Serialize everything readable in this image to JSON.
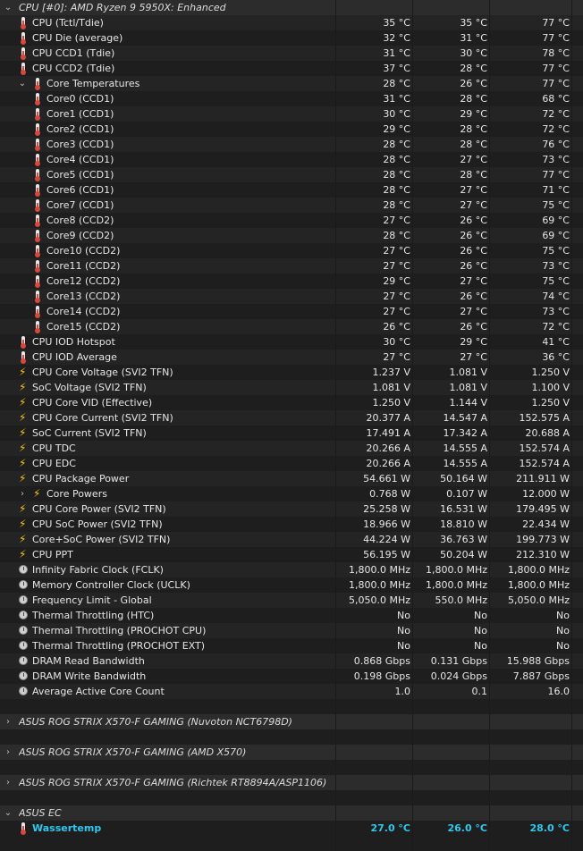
{
  "sections": [
    {
      "title": "CPU [#0]: AMD Ryzen 9 5950X: Enhanced",
      "expanded": true,
      "rows": [
        {
          "icon": "thermometer",
          "label": "CPU (Tctl/Tdie)",
          "v1": "35 °C",
          "v2": "35 °C",
          "v3": "77 °C"
        },
        {
          "icon": "thermometer",
          "label": "CPU Die (average)",
          "v1": "32 °C",
          "v2": "31 °C",
          "v3": "77 °C"
        },
        {
          "icon": "thermometer",
          "label": "CPU CCD1 (Tdie)",
          "v1": "31 °C",
          "v2": "30 °C",
          "v3": "78 °C"
        },
        {
          "icon": "thermometer",
          "label": "CPU CCD2 (Tdie)",
          "v1": "37 °C",
          "v2": "28 °C",
          "v3": "77 °C"
        },
        {
          "icon": "thermometer",
          "label": "Core Temperatures",
          "v1": "28 °C",
          "v2": "26 °C",
          "v3": "77 °C",
          "group": "expanded"
        },
        {
          "icon": "thermometer",
          "label": "Core0 (CCD1)",
          "v1": "31 °C",
          "v2": "28 °C",
          "v3": "68 °C",
          "child": true
        },
        {
          "icon": "thermometer",
          "label": "Core1 (CCD1)",
          "v1": "30 °C",
          "v2": "29 °C",
          "v3": "72 °C",
          "child": true
        },
        {
          "icon": "thermometer",
          "label": "Core2 (CCD1)",
          "v1": "29 °C",
          "v2": "28 °C",
          "v3": "72 °C",
          "child": true
        },
        {
          "icon": "thermometer",
          "label": "Core3 (CCD1)",
          "v1": "28 °C",
          "v2": "28 °C",
          "v3": "76 °C",
          "child": true
        },
        {
          "icon": "thermometer",
          "label": "Core4 (CCD1)",
          "v1": "28 °C",
          "v2": "27 °C",
          "v3": "73 °C",
          "child": true
        },
        {
          "icon": "thermometer",
          "label": "Core5 (CCD1)",
          "v1": "28 °C",
          "v2": "28 °C",
          "v3": "77 °C",
          "child": true
        },
        {
          "icon": "thermometer",
          "label": "Core6 (CCD1)",
          "v1": "28 °C",
          "v2": "27 °C",
          "v3": "71 °C",
          "child": true
        },
        {
          "icon": "thermometer",
          "label": "Core7 (CCD1)",
          "v1": "28 °C",
          "v2": "27 °C",
          "v3": "75 °C",
          "child": true
        },
        {
          "icon": "thermometer",
          "label": "Core8 (CCD2)",
          "v1": "27 °C",
          "v2": "26 °C",
          "v3": "69 °C",
          "child": true
        },
        {
          "icon": "thermometer",
          "label": "Core9 (CCD2)",
          "v1": "28 °C",
          "v2": "26 °C",
          "v3": "69 °C",
          "child": true
        },
        {
          "icon": "thermometer",
          "label": "Core10 (CCD2)",
          "v1": "27 °C",
          "v2": "26 °C",
          "v3": "75 °C",
          "child": true
        },
        {
          "icon": "thermometer",
          "label": "Core11 (CCD2)",
          "v1": "27 °C",
          "v2": "26 °C",
          "v3": "73 °C",
          "child": true
        },
        {
          "icon": "thermometer",
          "label": "Core12 (CCD2)",
          "v1": "29 °C",
          "v2": "27 °C",
          "v3": "75 °C",
          "child": true
        },
        {
          "icon": "thermometer",
          "label": "Core13 (CCD2)",
          "v1": "27 °C",
          "v2": "26 °C",
          "v3": "74 °C",
          "child": true
        },
        {
          "icon": "thermometer",
          "label": "Core14 (CCD2)",
          "v1": "27 °C",
          "v2": "27 °C",
          "v3": "73 °C",
          "child": true
        },
        {
          "icon": "thermometer",
          "label": "Core15 (CCD2)",
          "v1": "26 °C",
          "v2": "26 °C",
          "v3": "72 °C",
          "child": true
        },
        {
          "icon": "thermometer",
          "label": "CPU IOD Hotspot",
          "v1": "30 °C",
          "v2": "29 °C",
          "v3": "41 °C"
        },
        {
          "icon": "thermometer",
          "label": "CPU IOD Average",
          "v1": "27 °C",
          "v2": "27 °C",
          "v3": "36 °C"
        },
        {
          "icon": "bolt",
          "label": "CPU Core Voltage (SVI2 TFN)",
          "v1": "1.237 V",
          "v2": "1.081 V",
          "v3": "1.250 V"
        },
        {
          "icon": "bolt",
          "label": "SoC Voltage (SVI2 TFN)",
          "v1": "1.081 V",
          "v2": "1.081 V",
          "v3": "1.100 V"
        },
        {
          "icon": "bolt",
          "label": "CPU Core VID (Effective)",
          "v1": "1.250 V",
          "v2": "1.144 V",
          "v3": "1.250 V"
        },
        {
          "icon": "bolt",
          "label": "CPU Core Current (SVI2 TFN)",
          "v1": "20.377 A",
          "v2": "14.547 A",
          "v3": "152.575 A"
        },
        {
          "icon": "bolt",
          "label": "SoC Current (SVI2 TFN)",
          "v1": "17.491 A",
          "v2": "17.342 A",
          "v3": "20.688 A"
        },
        {
          "icon": "bolt",
          "label": "CPU TDC",
          "v1": "20.266 A",
          "v2": "14.555 A",
          "v3": "152.574 A"
        },
        {
          "icon": "bolt",
          "label": "CPU EDC",
          "v1": "20.266 A",
          "v2": "14.555 A",
          "v3": "152.574 A"
        },
        {
          "icon": "bolt",
          "label": "CPU Package Power",
          "v1": "54.661 W",
          "v2": "50.164 W",
          "v3": "211.911 W"
        },
        {
          "icon": "bolt",
          "label": "Core Powers",
          "v1": "0.768 W",
          "v2": "0.107 W",
          "v3": "12.000 W",
          "group": "collapsed"
        },
        {
          "icon": "bolt",
          "label": "CPU Core Power (SVI2 TFN)",
          "v1": "25.258 W",
          "v2": "16.531 W",
          "v3": "179.495 W"
        },
        {
          "icon": "bolt",
          "label": "CPU SoC Power (SVI2 TFN)",
          "v1": "18.966 W",
          "v2": "18.810 W",
          "v3": "22.434 W"
        },
        {
          "icon": "bolt",
          "label": "Core+SoC Power (SVI2 TFN)",
          "v1": "44.224 W",
          "v2": "36.763 W",
          "v3": "199.773 W"
        },
        {
          "icon": "bolt",
          "label": "CPU PPT",
          "v1": "56.195 W",
          "v2": "50.204 W",
          "v3": "212.310 W"
        },
        {
          "icon": "clock",
          "label": "Infinity Fabric Clock (FCLK)",
          "v1": "1,800.0 MHz",
          "v2": "1,800.0 MHz",
          "v3": "1,800.0 MHz"
        },
        {
          "icon": "clock",
          "label": "Memory Controller Clock (UCLK)",
          "v1": "1,800.0 MHz",
          "v2": "1,800.0 MHz",
          "v3": "1,800.0 MHz"
        },
        {
          "icon": "clock",
          "label": "Frequency Limit - Global",
          "v1": "5,050.0 MHz",
          "v2": "550.0 MHz",
          "v3": "5,050.0 MHz"
        },
        {
          "icon": "clock",
          "label": "Thermal Throttling (HTC)",
          "v1": "No",
          "v2": "No",
          "v3": "No"
        },
        {
          "icon": "clock",
          "label": "Thermal Throttling (PROCHOT CPU)",
          "v1": "No",
          "v2": "No",
          "v3": "No"
        },
        {
          "icon": "clock",
          "label": "Thermal Throttling (PROCHOT EXT)",
          "v1": "No",
          "v2": "No",
          "v3": "No"
        },
        {
          "icon": "clock",
          "label": "DRAM Read Bandwidth",
          "v1": "0.868 Gbps",
          "v2": "0.131 Gbps",
          "v3": "15.988 Gbps"
        },
        {
          "icon": "clock",
          "label": "DRAM Write Bandwidth",
          "v1": "0.198 Gbps",
          "v2": "0.024 Gbps",
          "v3": "7.887 Gbps"
        },
        {
          "icon": "clock",
          "label": "Average Active Core Count",
          "v1": "1.0",
          "v2": "0.1",
          "v3": "16.0"
        }
      ]
    },
    {
      "title": "ASUS ROG STRIX X570-F GAMING (Nuvoton NCT6798D)",
      "expanded": false,
      "rows": []
    },
    {
      "title": "ASUS ROG STRIX X570-F GAMING (AMD X570)",
      "expanded": false,
      "rows": []
    },
    {
      "title": "ASUS ROG STRIX X570-F GAMING (Richtek RT8894A/ASP1106)",
      "expanded": false,
      "rows": []
    },
    {
      "title": "ASUS EC",
      "expanded": true,
      "rows": [
        {
          "icon": "thermometer",
          "label": "Wassertemp",
          "v1": "27.0 °C",
          "v2": "26.0 °C",
          "v3": "28.0 °C",
          "highlight": true
        }
      ]
    }
  ],
  "colors": {
    "background": "#1b1b1b",
    "text": "#e6e6e6",
    "highlight": "#2ec8f0",
    "bolt": "#f7c61b",
    "thermometer": "#d9463b"
  }
}
